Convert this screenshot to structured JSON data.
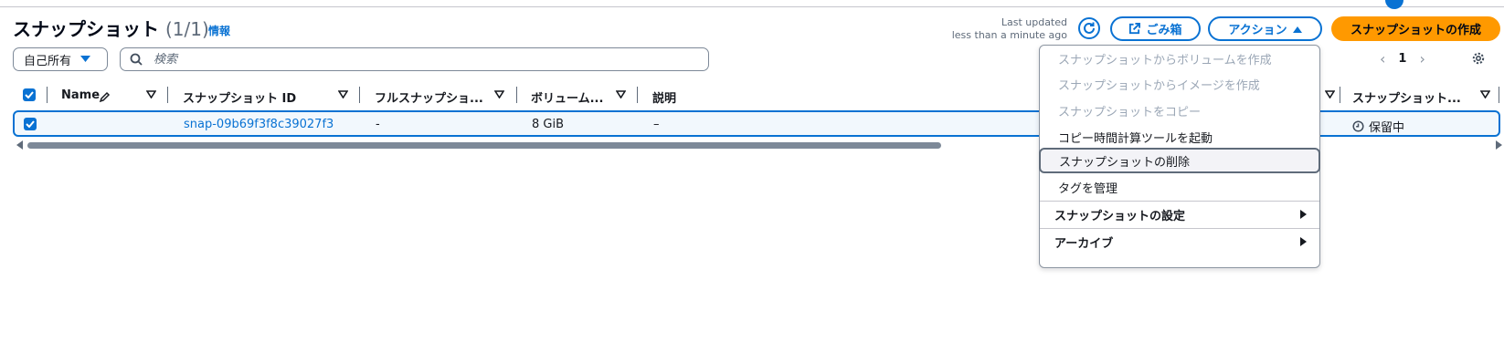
{
  "header": {
    "title": "スナップショット",
    "count": "(1/1)",
    "info_link": "情報",
    "last_updated_line1": "Last updated",
    "last_updated_line2": "less than a minute ago",
    "recycle_bin_label": "ごみ箱",
    "actions_label": "アクション",
    "create_label": "スナップショットの作成"
  },
  "filter": {
    "owner_select_value": "自己所有",
    "search_placeholder": "検索"
  },
  "pagination": {
    "current_page": "1"
  },
  "table": {
    "columns": [
      "Name",
      "スナップショット ID",
      "フルスナップショ...",
      "ボリューム...",
      "説明",
      "スナップショット..."
    ],
    "rows": [
      {
        "name": "",
        "snapshot_id": "snap-09b69f3f8c39027f3",
        "full_snapshot": "-",
        "volume": "8 GiB",
        "description": "–",
        "status": "保留中"
      }
    ]
  },
  "actions_menu": {
    "items": [
      {
        "label": "スナップショットからボリュームを作成",
        "disabled": true
      },
      {
        "label": "スナップショットからイメージを作成",
        "disabled": true
      },
      {
        "label": "スナップショットをコピー",
        "disabled": true
      },
      {
        "label": "コピー時間計算ツールを起動",
        "disabled": false
      },
      {
        "label": "スナップショットの削除",
        "disabled": false
      },
      {
        "label": "タグを管理",
        "disabled": false
      }
    ],
    "groups": [
      {
        "label": "スナップショットの設定"
      },
      {
        "label": "アーカイブ"
      }
    ]
  },
  "colors": {
    "primary": "#0972d3",
    "accent": "#ff9900"
  },
  "icons": [
    "refresh-icon",
    "external-link-icon",
    "caret-up-icon",
    "caret-down-icon",
    "search-icon",
    "pencil-icon",
    "sort-icon",
    "settings-icon",
    "clock-icon",
    "chevron-left-icon",
    "chevron-right-icon"
  ]
}
